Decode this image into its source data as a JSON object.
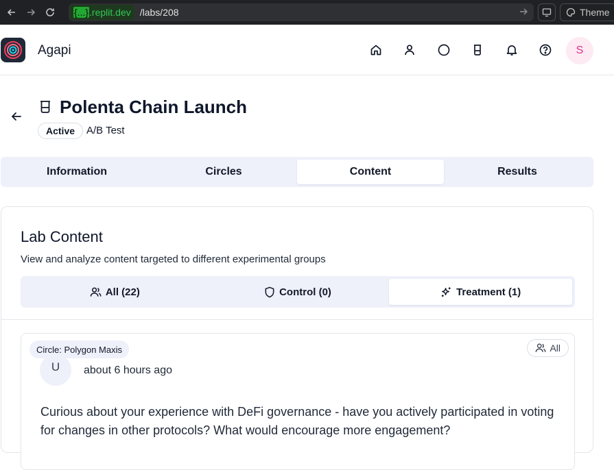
{
  "browser": {
    "url_badge_braces": "{...}",
    "url_host": ".replit.dev",
    "url_path": "/labs/208",
    "theme_label": "Theme"
  },
  "header": {
    "app_name": "Agapi",
    "avatar_initial": "S",
    "icons": [
      "home-icon",
      "user-icon",
      "circle-icon",
      "beaker-icon",
      "bell-icon",
      "help-icon"
    ]
  },
  "lab": {
    "title": "Polenta Chain Launch",
    "status": "Active",
    "type": "A/B Test"
  },
  "tabs": [
    {
      "label": "Information",
      "active": false
    },
    {
      "label": "Circles",
      "active": false
    },
    {
      "label": "Content",
      "active": true
    },
    {
      "label": "Results",
      "active": false
    }
  ],
  "content_card": {
    "title": "Lab Content",
    "subtitle": "View and analyze content targeted to different experimental groups",
    "sub_tabs": [
      {
        "label": "All (22)",
        "icon": "users-icon",
        "active": false
      },
      {
        "label": "Control (0)",
        "icon": "shield-icon",
        "active": false
      },
      {
        "label": "Treatment (1)",
        "icon": "sparkles-icon",
        "active": true
      }
    ]
  },
  "post": {
    "circle": "Circle: Polygon Maxis",
    "audience": "All",
    "author_initial": "U",
    "time": "about 6 hours ago",
    "body": "Curious about your experience with DeFi governance - have you actively participated in voting for changes in other protocols? What would encourage more engagement?"
  },
  "colors": {
    "accent_tab_bg": "#eef0fa",
    "avatar_pink": "#e0338a",
    "url_green": "#34c759"
  }
}
